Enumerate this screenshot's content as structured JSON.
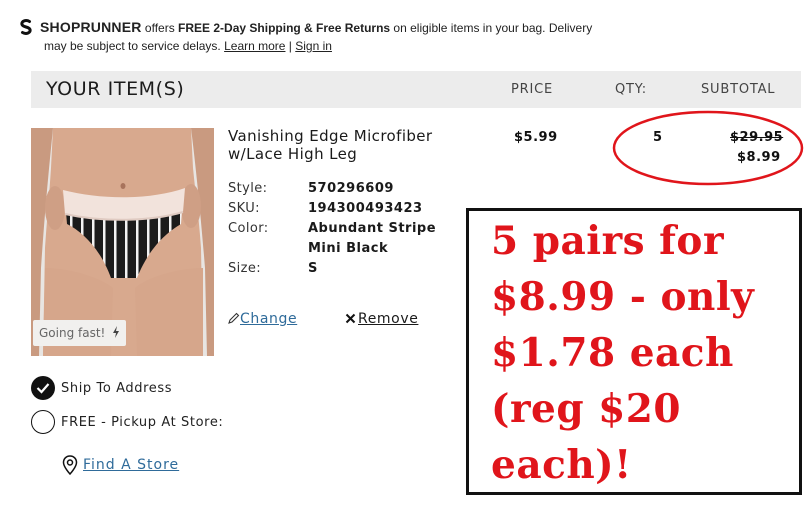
{
  "banner": {
    "brand": "SHOPRUNNER",
    "text1": " offers ",
    "bold1": "FREE 2-Day Shipping & Free Returns",
    "text2": " on eligible items in your bag. Delivery",
    "text3": "may be subject to service delays. ",
    "learn_more": "Learn more",
    "separator": " | ",
    "sign_in": "Sign in"
  },
  "header": {
    "title": "YOUR ITEM(S)",
    "price": "PRICE",
    "qty": "QTY:",
    "subtotal": "SUBTOTAL"
  },
  "item": {
    "badge": "Going fast!",
    "name": "Vanishing Edge Microfiber w/Lace High Leg",
    "style_label": "Style:",
    "style_value": "570296609",
    "sku_label": "SKU:",
    "sku_value": "194300493423",
    "color_label": "Color:",
    "color_value": "Abundant Stripe Mini Black",
    "size_label": "Size:",
    "size_value": "S",
    "change_label": "Change",
    "remove_label": "Remove",
    "price": "$5.99",
    "qty": "5",
    "subtotal_original": "$29.95",
    "subtotal_sale": "$8.99"
  },
  "shipping": {
    "ship_to_address": "Ship To Address",
    "pickup": "FREE - Pickup At Store:",
    "find_store": "Find A Store",
    "selected": "ship_to_address"
  },
  "annotation": {
    "promo": "5 pairs for $8.99 - only $1.78 each (reg $20 each)!",
    "color": "#e0151b"
  },
  "icons": {
    "logo": "shoprunner-logo-icon",
    "lightning": "lightning-icon",
    "pencil": "pencil-icon",
    "close": "close-icon",
    "check": "check-icon",
    "pin": "map-pin-icon"
  }
}
